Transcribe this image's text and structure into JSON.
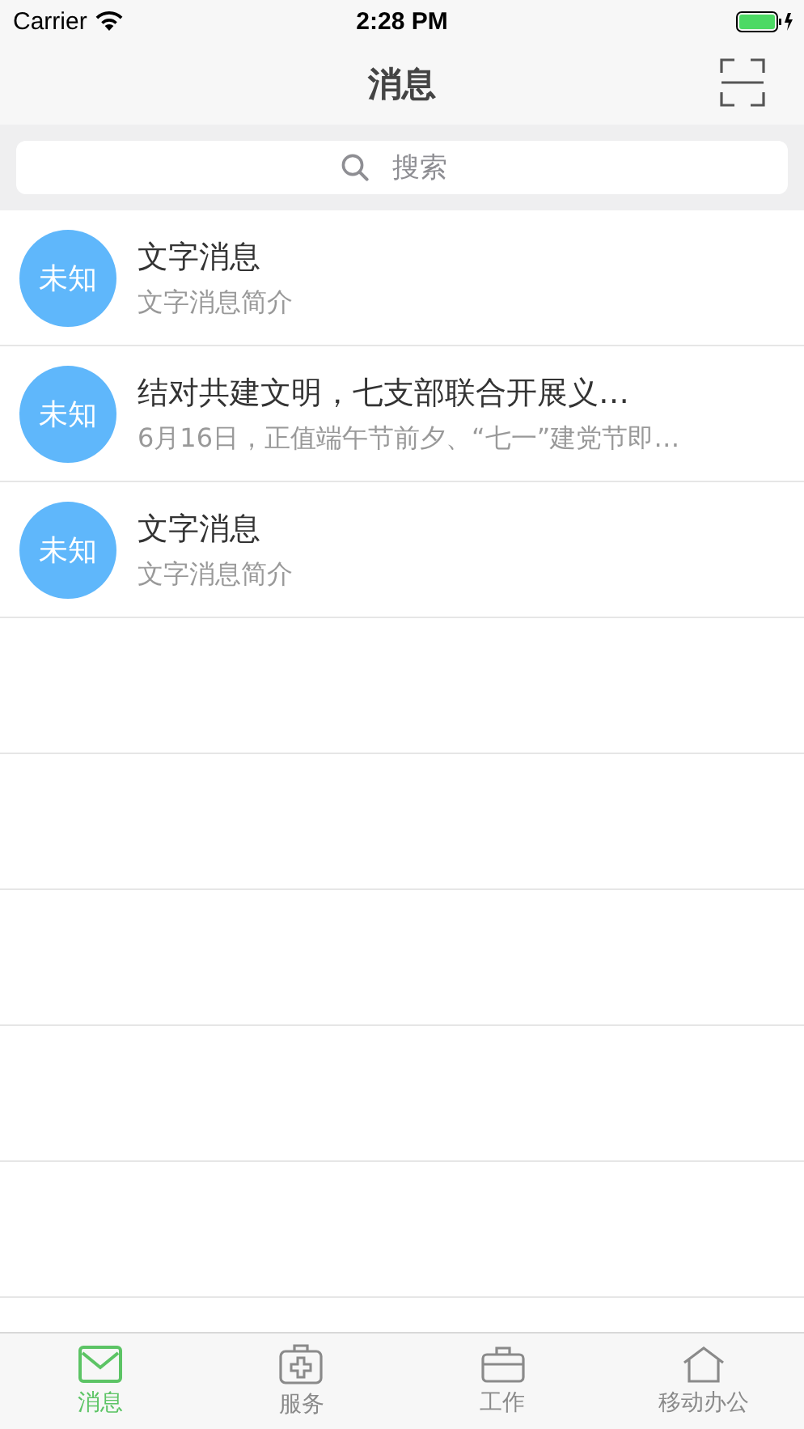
{
  "status_bar": {
    "carrier": "Carrier",
    "time": "2:28 PM"
  },
  "nav_bar": {
    "title": "消息"
  },
  "search": {
    "placeholder": "搜索"
  },
  "messages": [
    {
      "avatar": "未知",
      "title": "文字消息",
      "summary": "文字消息简介"
    },
    {
      "avatar": "未知",
      "title": "结对共建文明，七支部联合开展义…",
      "summary": "6月16日，正值端午节前夕、“七一”建党节即…"
    },
    {
      "avatar": "未知",
      "title": "文字消息",
      "summary": "文字消息简介"
    }
  ],
  "tab_bar": [
    {
      "label": "消息",
      "kind": "mail",
      "selected": true
    },
    {
      "label": "服务",
      "kind": "kit",
      "selected": false
    },
    {
      "label": "工作",
      "kind": "work",
      "selected": false
    },
    {
      "label": "移动办公",
      "kind": "office",
      "selected": false
    }
  ]
}
